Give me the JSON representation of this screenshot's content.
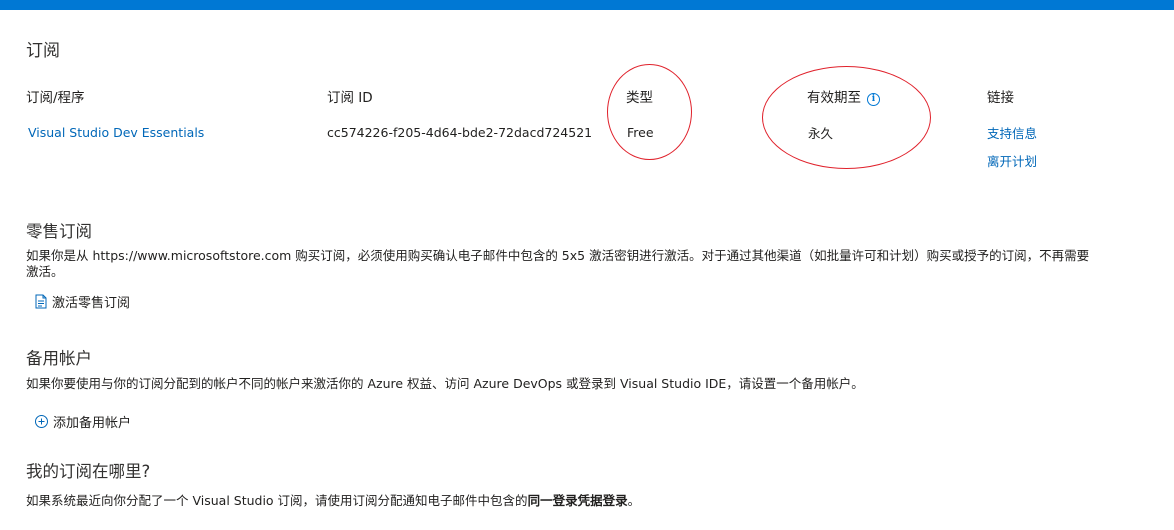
{
  "page": {
    "title": "订阅",
    "accent": "#0078d4",
    "annotation_color": "#e0212b"
  },
  "table": {
    "headers": {
      "program": "订阅/程序",
      "id": "订阅 ID",
      "type": "类型",
      "expires": "有效期至",
      "links": "链接"
    },
    "row": {
      "program": "Visual Studio Dev Essentials",
      "id": "cc574226-f205-4d64-bde2-72dacd724521",
      "type": "Free",
      "expires": "永久",
      "links": [
        "支持信息",
        "离开计划"
      ]
    },
    "info_icon": "info-icon"
  },
  "retail": {
    "title": "零售订阅",
    "text_line1": "如果你是从 https://www.microsoftstore.com 购买订阅，必须使用购买确认电子邮件中包含的 5x5 激活密钥进行激活。对于通过其他渠道（如批量许可和计划）购买或授予的订阅，不再需要",
    "text_line2": "激活。",
    "action_label": "激活零售订阅",
    "action_icon": "document-icon"
  },
  "alternate": {
    "title": "备用帐户",
    "text": "如果你要使用与你的订阅分配到的帐户不同的帐户来激活你的 Azure 权益、访问 Azure DevOps 或登录到 Visual Studio IDE，请设置一个备用帐户。",
    "action_label": "添加备用帐户",
    "action_icon": "add-circle-icon"
  },
  "where": {
    "title": "我的订阅在哪里?",
    "text_prefix": "如果系统最近向你分配了一个 Visual Studio 订阅，请使用订阅分配通知电子邮件中包含的",
    "text_bold": "同一登录凭据登录",
    "text_suffix": "。"
  }
}
